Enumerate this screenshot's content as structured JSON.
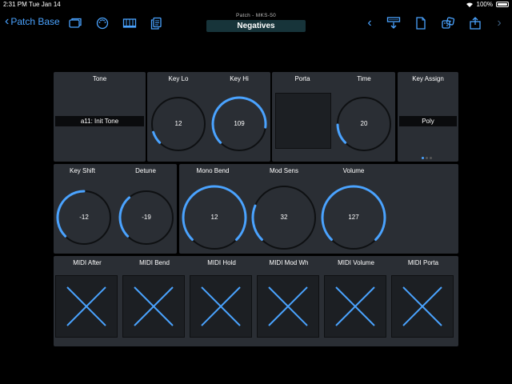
{
  "status": {
    "time": "2:31 PM",
    "date": "Tue Jan 14",
    "battery": "100%"
  },
  "nav": {
    "back_label": "Patch Base",
    "subtitle": "Patch - MKS-50",
    "title": "Negatives"
  },
  "colors": {
    "accent": "#4aa3ff",
    "panel": "#2a2e34",
    "knob_track": "#0e1012"
  },
  "tone": {
    "label": "Tone",
    "value": "a11: Init Tone"
  },
  "key_lo": {
    "label": "Key Lo",
    "value": "12",
    "level": 0.1
  },
  "key_hi": {
    "label": "Key Hi",
    "value": "109",
    "level": 0.86
  },
  "porta": {
    "label": "Porta"
  },
  "time": {
    "label": "Time",
    "value": "20",
    "level": 0.16
  },
  "key_assign": {
    "label": "Key Assign",
    "value": "Poly"
  },
  "key_shift": {
    "label": "Key Shift",
    "value": "-12",
    "level": 0.5
  },
  "detune": {
    "label": "Detune",
    "value": "-19",
    "level": 0.35
  },
  "mono_bend": {
    "label": "Mono Bend",
    "value": "12",
    "level": 1.0
  },
  "mod_sens": {
    "label": "Mod Sens",
    "value": "32",
    "level": 0.25
  },
  "volume": {
    "label": "Volume",
    "value": "127",
    "level": 1.0
  },
  "midi": [
    {
      "label": "MIDI After"
    },
    {
      "label": "MIDI Bend"
    },
    {
      "label": "MIDI Hold"
    },
    {
      "label": "MIDI Mod Wh"
    },
    {
      "label": "MIDI Volume"
    },
    {
      "label": "MIDI Porta"
    }
  ]
}
